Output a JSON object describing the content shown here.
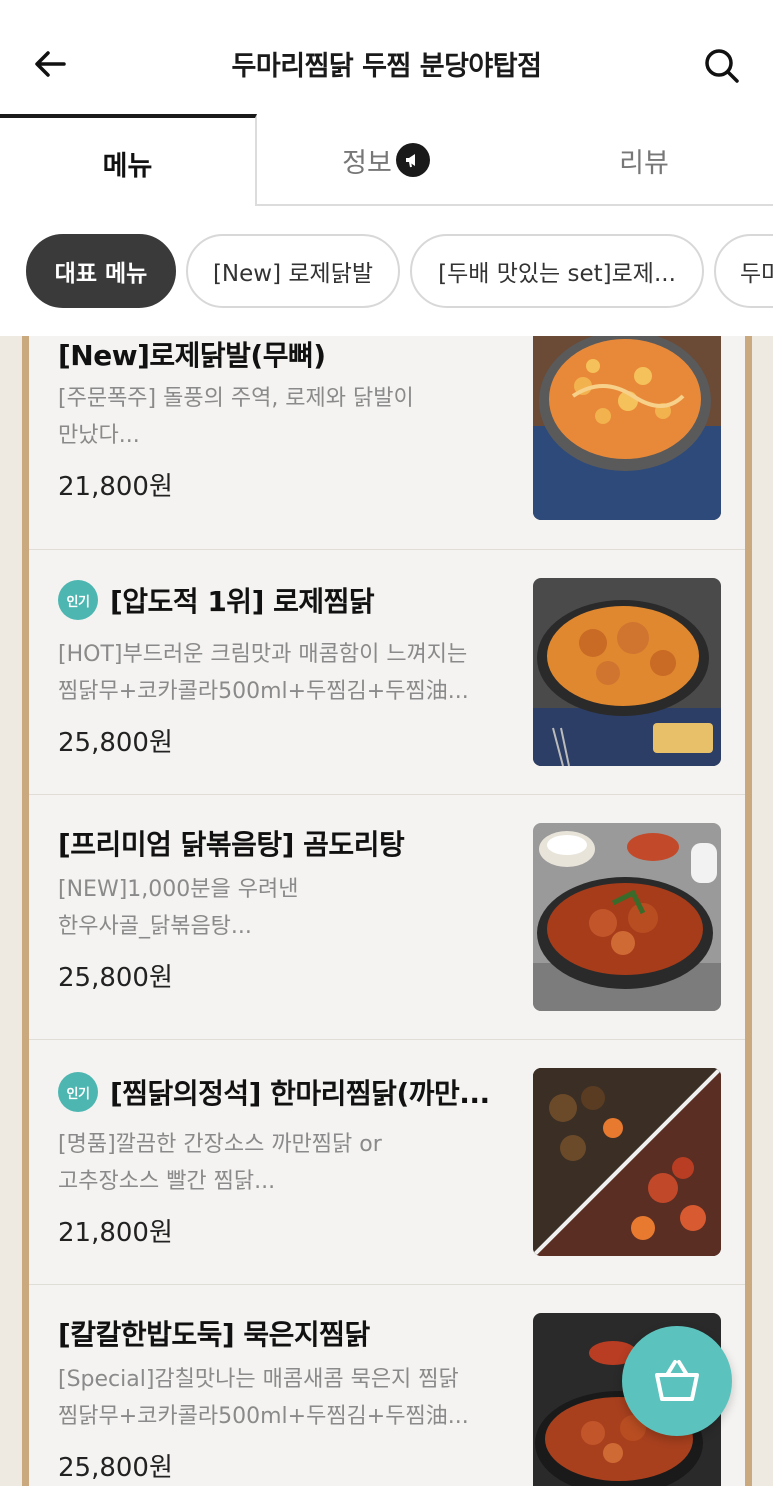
{
  "header": {
    "title": "두마리찜닭 두찜 분당야탑점",
    "back_icon": "arrow-left-icon",
    "search_icon": "search-icon"
  },
  "tabs": [
    {
      "label": "메뉴",
      "active": true
    },
    {
      "label": "정보",
      "active": false,
      "badge_icon": "megaphone-icon"
    },
    {
      "label": "리뷰",
      "active": false
    }
  ],
  "chips": [
    {
      "label": "대표 메뉴",
      "active": true
    },
    {
      "label": "[New] 로제닭발",
      "active": false
    },
    {
      "label": "[두배 맛있는 set]로제...",
      "active": false
    },
    {
      "label": "두마",
      "active": false
    }
  ],
  "menu_items": [
    {
      "name": "[New]로제닭발(무뼈)",
      "popular": false,
      "desc_line1": "[주문폭주] 돌풍의 주역, 로제와 닭발이",
      "desc_line2": "만났다...",
      "price": "21,800원"
    },
    {
      "name": "[압도적 1위] 로제찜닭",
      "popular": true,
      "desc_line1": "[HOT]부드러운 크림맛과 매콤함이 느껴지는",
      "desc_line2": "찜닭무+코카콜라500ml+두찜김+두찜油...",
      "price": "25,800원"
    },
    {
      "name": "[프리미엄 닭볶음탕] 곰도리탕",
      "popular": false,
      "desc_line1": "[NEW]1,000분을 우려낸",
      "desc_line2": "한우사골_닭볶음탕...",
      "price": "25,800원"
    },
    {
      "name": "[찜닭의정석] 한마리찜닭(까만...",
      "popular": true,
      "desc_line1": "[명품]깔끔한 간장소스 까만찜닭 or",
      "desc_line2": "고추장소스 빨간 찜닭...",
      "price": "21,800원"
    },
    {
      "name": "[칼칼한밥도둑] 묵은지찜닭",
      "popular": false,
      "desc_line1": "[Special]감칠맛나는 매콤새콤 묵은지 찜닭",
      "desc_line2": "찜닭무+코카콜라500ml+두찜김+두찜油...",
      "price": "25,800원"
    }
  ],
  "popular_badge_label": "인기",
  "fab_icon": "shopping-basket-icon",
  "colors": {
    "accent_teal": "#4db6b1",
    "fab_teal": "#5cc2bd",
    "frame_brown": "#c9a97d",
    "chip_active": "#3a3a3a"
  }
}
